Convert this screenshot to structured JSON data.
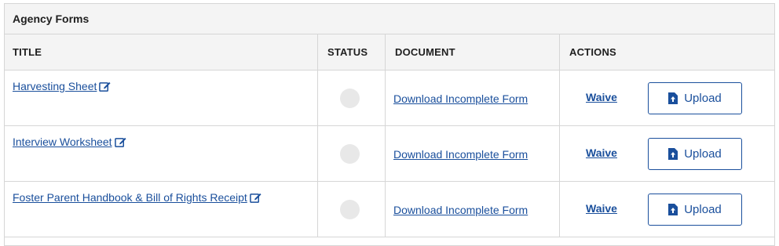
{
  "panel": {
    "title": "Agency Forms"
  },
  "table": {
    "headers": {
      "title": "TITLE",
      "status": "STATUS",
      "document": "DOCUMENT",
      "actions": "ACTIONS"
    },
    "rows": [
      {
        "title": "Harvesting Sheet",
        "document_link": "Download Incomplete Form",
        "waive_label": "Waive",
        "upload_label": "Upload"
      },
      {
        "title": "Interview Worksheet",
        "document_link": "Download Incomplete Form",
        "waive_label": "Waive",
        "upload_label": "Upload"
      },
      {
        "title": "Foster Parent Handbook & Bill of Rights Receipt",
        "document_link": "Download Incomplete Form",
        "waive_label": "Waive",
        "upload_label": "Upload"
      }
    ]
  },
  "icons": {
    "edit": "edit-icon",
    "upload": "upload-file-icon",
    "status": "status-indicator"
  },
  "colors": {
    "link": "#1a4f9c",
    "header_bg": "#f4f4f4",
    "border": "#d6d6d6",
    "status_empty": "#e8e8e8"
  }
}
